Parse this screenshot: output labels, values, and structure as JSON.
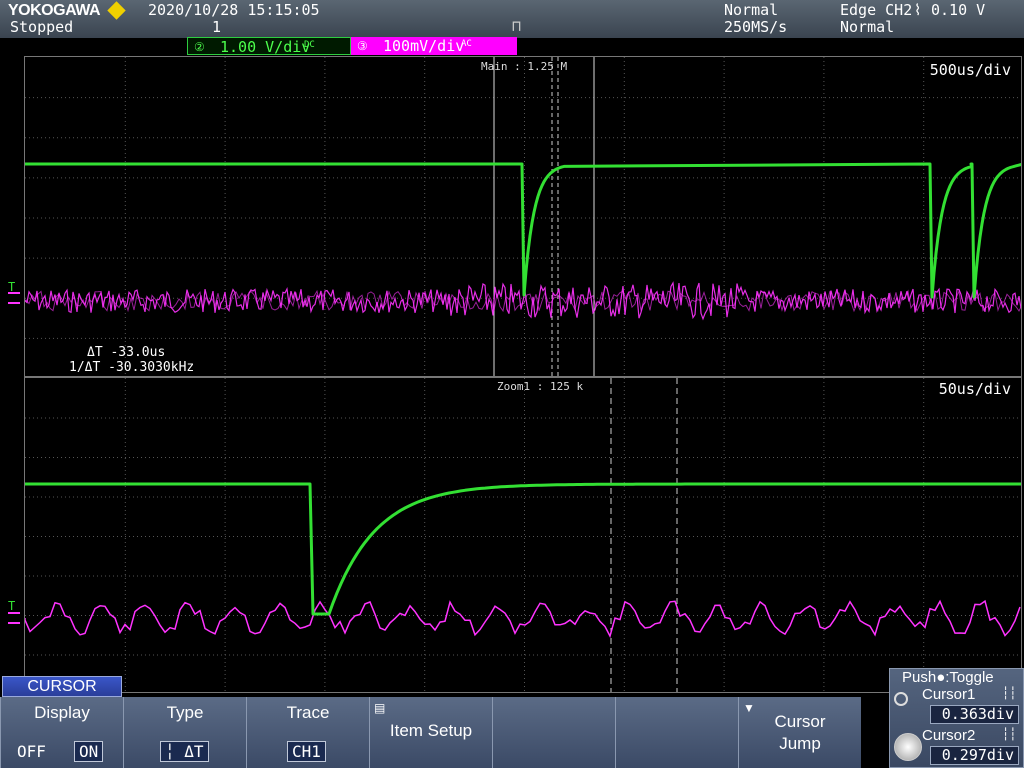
{
  "header": {
    "brand": "YOKOGAWA",
    "state": "Stopped",
    "datetime": "2020/10/28 15:15:05",
    "acq_count": "1",
    "trigger_mode": "Normal",
    "sample_rate": "250MS/s",
    "trigger_spec": "Edge CH2",
    "trigger_level": "0.10 V",
    "trigger_mode2": "Normal"
  },
  "channels": {
    "ch2": {
      "number": "2",
      "scale": "1.00 V/div",
      "color": "#33dd33"
    },
    "ch3": {
      "number": "3",
      "scale": "100mV/div",
      "color": "#ff33ff"
    }
  },
  "main_pane": {
    "timebase": "500us/div",
    "zoom_label": "Main : 1.25 M",
    "delta_t": "ΔT  -33.0us",
    "inv_delta_t": "1/ΔT  -30.3030kHz"
  },
  "zoom_pane": {
    "timebase": "50us/div",
    "zoom_label": "Zoom1 : 125 k"
  },
  "menu": {
    "title": "CURSOR",
    "display_label": "Display",
    "display_off": "OFF",
    "display_on": "ON",
    "type_label": "Type",
    "type_value": "╎ ΔT",
    "trace_label": "Trace",
    "trace_value": "CH1",
    "item_setup_label": "Item Setup",
    "cursor_jump_label": "Cursor\nJump"
  },
  "right_panel": {
    "toggle_label": "Push●:Toggle",
    "cursor1_label": "Cursor1",
    "cursor1_value": "0.363div",
    "cursor2_label": "Cursor2",
    "cursor2_value": "0.297div"
  },
  "colors": {
    "trace_green": "#33e033",
    "trace_magenta": "#ff33ff",
    "grid": "#555555",
    "softkey": "#4a5a78"
  }
}
